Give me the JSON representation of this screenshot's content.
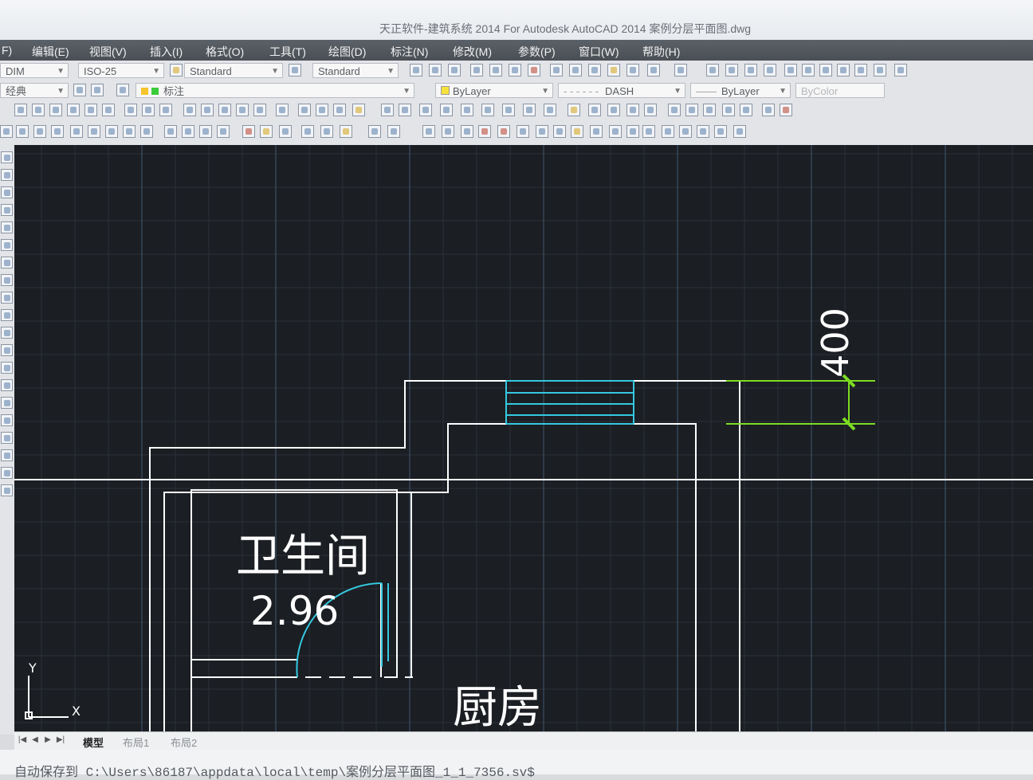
{
  "window": {
    "title": "天正软件-建筑系统 2014  For Autodesk AutoCAD 2014    案例分层平面图.dwg"
  },
  "menu": {
    "items": [
      "F)",
      "编辑(E)",
      "视图(V)",
      "插入(I)",
      "格式(O)",
      "工具(T)",
      "绘图(D)",
      "标注(N)",
      "修改(M)",
      "参数(P)",
      "窗口(W)",
      "帮助(H)"
    ]
  },
  "toolbar1": {
    "dimstyle_name": "DIM",
    "dimstyle_value": "ISO-25",
    "textstyle": "Standard",
    "tablestyle": "Standard"
  },
  "toolbar2": {
    "workspace": "经典",
    "layer": "标注",
    "color": "ByLayer",
    "linetype": "DASH",
    "lineweight": "ByLayer",
    "plotstyle": "ByColor"
  },
  "drawing": {
    "dimension_text": "400",
    "room1_name": "卫生间",
    "room1_area": "2.96",
    "room2_name": "厨房",
    "ucs_x": "X",
    "ucs_y": "Y"
  },
  "tabs": {
    "model": "模型",
    "layout1": "布局1",
    "layout2": "布局2"
  },
  "command_line": {
    "text": "自动保存到 C:\\Users\\86187\\appdata\\local\\temp\\案例分层平面图_1_1_7356.sv$"
  },
  "colors": {
    "canvas_bg": "#1b1e23",
    "wall": "#ffffff",
    "stair_cyan": "#35c8e0",
    "dimension_green": "#7ddc23"
  }
}
